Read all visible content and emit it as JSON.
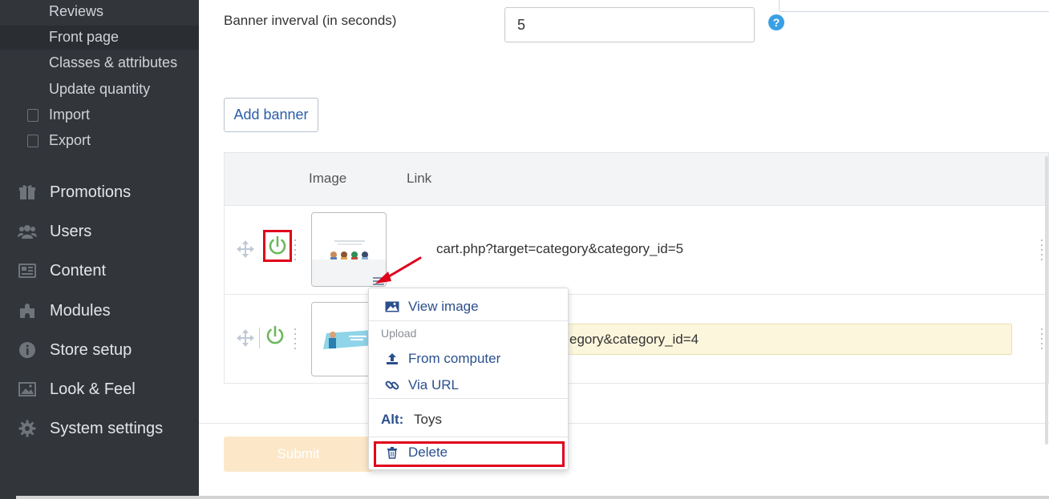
{
  "sidebar": {
    "sub_items": [
      {
        "label": "Reviews"
      },
      {
        "label": "Front page"
      },
      {
        "label": "Classes & attributes"
      },
      {
        "label": "Update quantity"
      },
      {
        "label": "Import"
      },
      {
        "label": "Export"
      }
    ],
    "main_items": [
      {
        "label": "Promotions",
        "icon": "gift-icon"
      },
      {
        "label": "Users",
        "icon": "users-icon"
      },
      {
        "label": "Content",
        "icon": "content-icon"
      },
      {
        "label": "Modules",
        "icon": "puzzle-icon"
      },
      {
        "label": "Store setup",
        "icon": "info-icon"
      },
      {
        "label": "Look & Feel",
        "icon": "image-icon"
      },
      {
        "label": "System settings",
        "icon": "gear-icon"
      }
    ]
  },
  "settings": {
    "interval_label": "Banner inverval (in seconds)",
    "interval_value": "5",
    "help": "?"
  },
  "add_banner_label": "Add banner",
  "table": {
    "headers": {
      "image": "Image",
      "link": "Link"
    },
    "rows": [
      {
        "link": "cart.php?target=category&category_id=5"
      },
      {
        "link": "egory&category_id=4"
      }
    ]
  },
  "menu": {
    "view_image": "View image",
    "upload_header": "Upload",
    "from_computer": "From computer",
    "via_url": "Via URL",
    "alt_key": "Alt:",
    "alt_value": "Toys",
    "delete": "Delete"
  },
  "submit_label": "Submit",
  "colors": {
    "sidebar_bg": "#32363b",
    "accent_blue": "#2b4f8c",
    "power_green": "#6cb85c",
    "highlight_red": "#e0001b"
  }
}
